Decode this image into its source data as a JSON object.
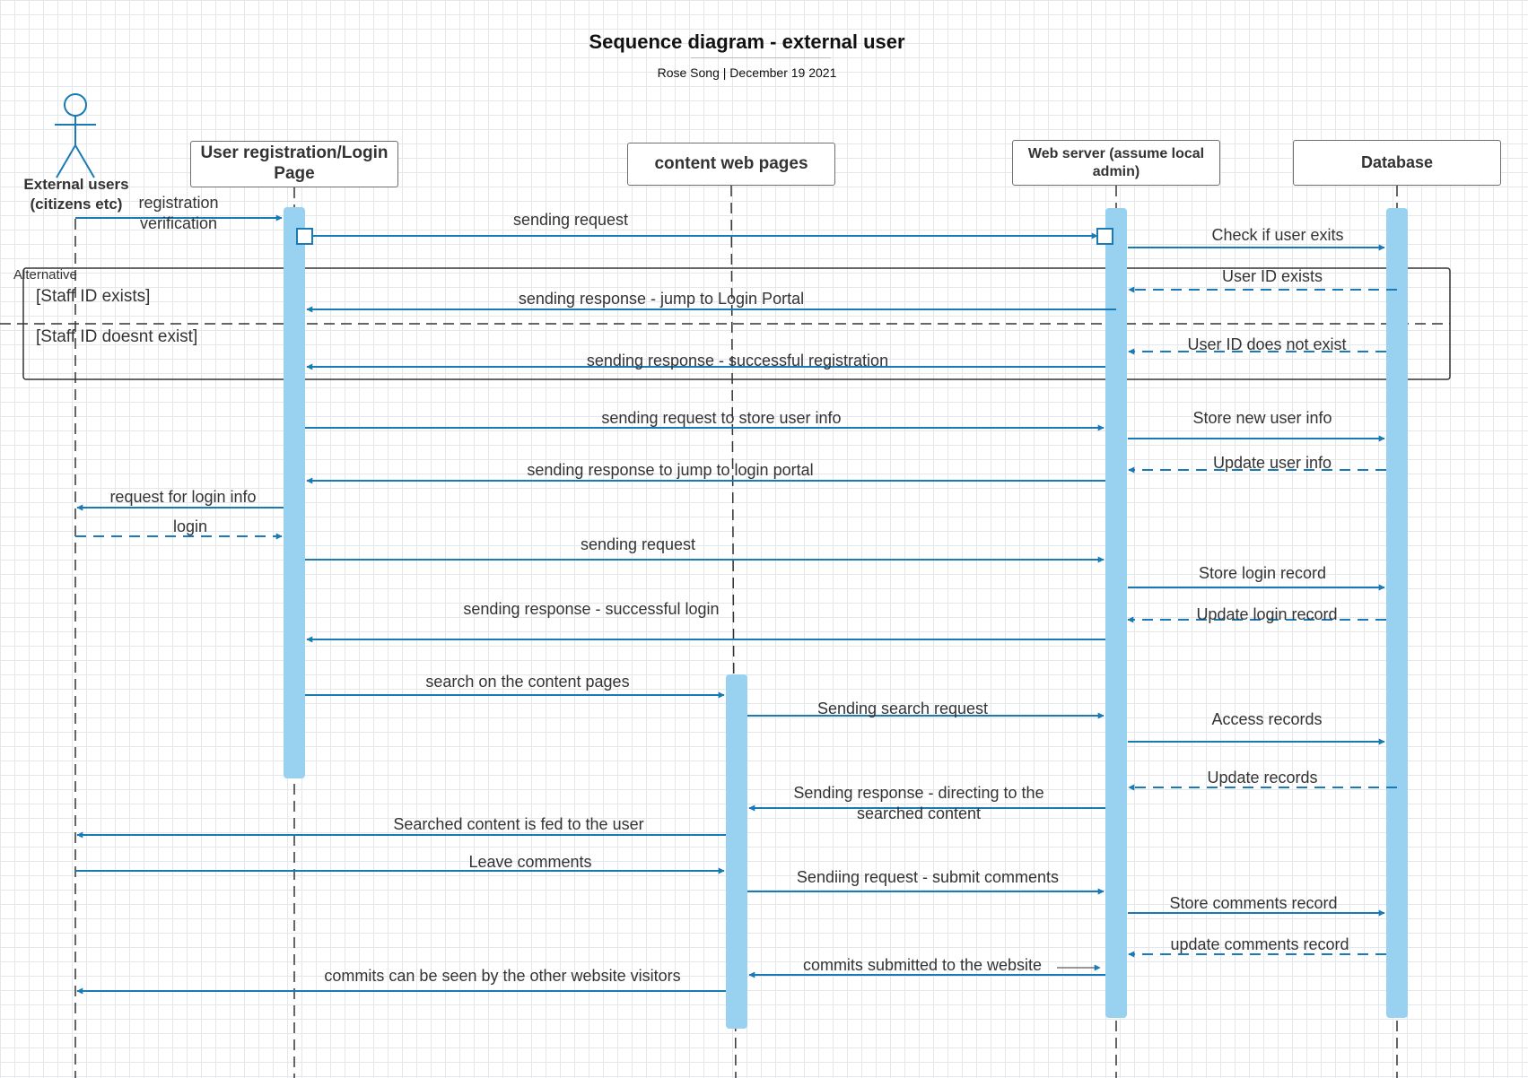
{
  "title": "Sequence diagram - external user",
  "subtitle": "Rose Song |  December 19 2021",
  "actor": {
    "label": "External users (citizens etc)"
  },
  "lifelines": {
    "registration": "User registration/Login Page",
    "content": "content web pages",
    "webserver": "Web server (assume local admin)",
    "database": "Database"
  },
  "fragment": {
    "label": "Alternative",
    "guard1": "[Staff ID exists]",
    "guard2": "[Staff ID doesnt exist]"
  },
  "messages": [
    {
      "text": "registration verification",
      "from": "actor",
      "to": "registration",
      "style": "solid"
    },
    {
      "text": "sending request",
      "from": "registration",
      "to": "webserver",
      "style": "solid"
    },
    {
      "text": "Check if user exits",
      "from": "webserver",
      "to": "database",
      "style": "solid"
    },
    {
      "text": "User ID exists",
      "from": "database",
      "to": "webserver",
      "style": "dashed"
    },
    {
      "text": "sending response - jump to Login Portal",
      "from": "webserver",
      "to": "registration",
      "style": "solid"
    },
    {
      "text": "User ID does not exist",
      "from": "database",
      "to": "webserver",
      "style": "dashed"
    },
    {
      "text": "sending response - successful registration",
      "from": "webserver",
      "to": "registration",
      "style": "solid"
    },
    {
      "text": "sending request to store user info",
      "from": "registration",
      "to": "webserver",
      "style": "solid"
    },
    {
      "text": "Store new user info",
      "from": "webserver",
      "to": "database",
      "style": "solid"
    },
    {
      "text": "Update user info",
      "from": "database",
      "to": "webserver",
      "style": "dashed"
    },
    {
      "text": "sending response to jump to login portal",
      "from": "webserver",
      "to": "registration",
      "style": "solid"
    },
    {
      "text": "request for login info",
      "from": "registration",
      "to": "actor",
      "style": "solid"
    },
    {
      "text": "login",
      "from": "actor",
      "to": "registration",
      "style": "dashed"
    },
    {
      "text": "sending request",
      "from": "registration",
      "to": "webserver",
      "style": "solid"
    },
    {
      "text": "Store login record",
      "from": "webserver",
      "to": "database",
      "style": "solid"
    },
    {
      "text": "Update login record",
      "from": "database",
      "to": "webserver",
      "style": "dashed"
    },
    {
      "text": "sending response - successful login",
      "from": "webserver",
      "to": "registration",
      "style": "solid"
    },
    {
      "text": "search on the content pages",
      "from": "registration",
      "to": "content",
      "style": "solid"
    },
    {
      "text": "Sending search request",
      "from": "content",
      "to": "webserver",
      "style": "solid"
    },
    {
      "text": "Access records",
      "from": "webserver",
      "to": "database",
      "style": "solid"
    },
    {
      "text": "Update records",
      "from": "database",
      "to": "webserver",
      "style": "dashed"
    },
    {
      "text": "Sending response - directing to the searched content",
      "from": "webserver",
      "to": "content",
      "style": "solid"
    },
    {
      "text": "Searched content is fed to the user",
      "from": "content",
      "to": "actor",
      "style": "solid"
    },
    {
      "text": "Leave comments",
      "from": "actor",
      "to": "content",
      "style": "solid"
    },
    {
      "text": "Sendiing request - submit comments",
      "from": "content",
      "to": "webserver",
      "style": "solid"
    },
    {
      "text": "Store comments record",
      "from": "webserver",
      "to": "database",
      "style": "solid"
    },
    {
      "text": "update comments record",
      "from": "database",
      "to": "webserver",
      "style": "dashed"
    },
    {
      "text": "commits submitted to the website",
      "from": "webserver",
      "to": "content",
      "style": "solid"
    },
    {
      "text": "commits can be seen by the other website visitors",
      "from": "content",
      "to": "actor",
      "style": "solid"
    }
  ],
  "colors": {
    "arrow": "#1a7ab5",
    "activation": "#99d1f1",
    "actor": "#1a7ab5",
    "lifeline": "#333333",
    "frame": "#333333"
  }
}
